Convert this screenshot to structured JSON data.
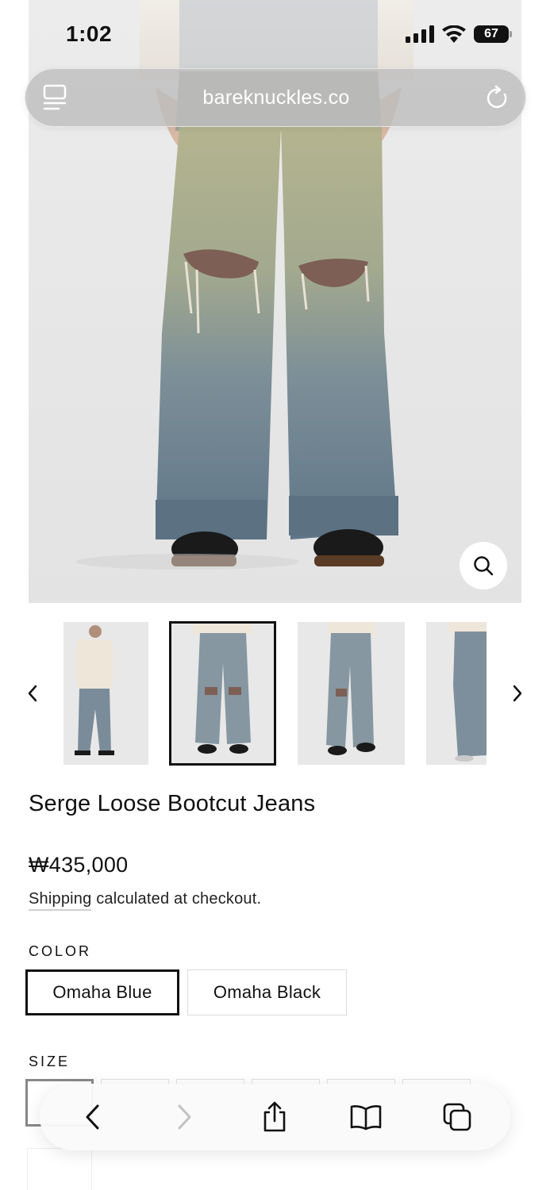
{
  "status_bar": {
    "time": "1:02",
    "battery": "67"
  },
  "address_bar": {
    "url": "bareknuckles.co"
  },
  "hero": {
    "image_alt": "Serge Loose Bootcut Jeans front view"
  },
  "thumbnails": {
    "count": 4,
    "selected_index": 1
  },
  "product": {
    "title": "Serge Loose Bootcut Jeans",
    "price": "₩435,000",
    "shipping_link": "Shipping",
    "shipping_rest": " calculated at checkout."
  },
  "color": {
    "label": "COLOR",
    "options": [
      "Omaha Blue",
      "Omaha Black"
    ],
    "selected": "Omaha Blue"
  },
  "size": {
    "label": "SIZE"
  },
  "icons": {
    "tabs": "tabs-icon",
    "reload": "reload-icon",
    "zoom": "magnifier-icon",
    "prev": "chevron-left-icon",
    "next": "chevron-right-icon",
    "back": "back-icon",
    "forward": "forward-icon",
    "share": "share-icon",
    "bookmarks": "book-icon",
    "tab_switcher": "tabs-switcher-icon"
  },
  "colors": {
    "accent": "#111111",
    "denim": "#6f8499",
    "background": "#ffffff"
  }
}
